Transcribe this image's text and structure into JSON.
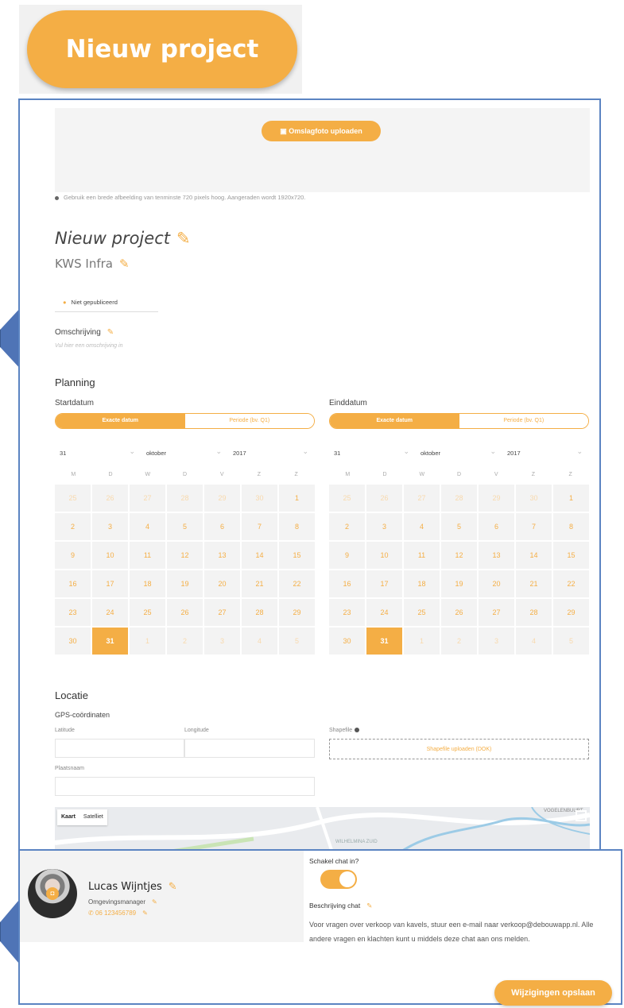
{
  "top_button": {
    "label": "Nieuw project"
  },
  "cover": {
    "upload_label": "Omslagfoto uploaden",
    "hint": "Gebruik een brede afbeelding van tenminste 720 pixels hoog. Aangeraden wordt 1920x720."
  },
  "project": {
    "title": "Nieuw project",
    "company": "KWS Infra",
    "status": "Niet gepubliceerd"
  },
  "description": {
    "label": "Omschrijving",
    "placeholder": "Vul hier een omschrijving in"
  },
  "planning": {
    "heading": "Planning",
    "start": {
      "label": "Startdatum",
      "toggle_exact": "Exacte datum",
      "toggle_period": "Periode (bv. Q1)",
      "day": "31",
      "month": "oktober",
      "year": "2017"
    },
    "end": {
      "label": "Einddatum",
      "toggle_exact": "Exacte datum",
      "toggle_period": "Periode (bv. Q1)",
      "day": "31",
      "month": "oktober",
      "year": "2017"
    },
    "weekdays": [
      "M",
      "D",
      "W",
      "D",
      "V",
      "Z",
      "Z"
    ],
    "days": [
      "25",
      "26",
      "27",
      "28",
      "29",
      "30",
      "1",
      "2",
      "3",
      "4",
      "5",
      "6",
      "7",
      "8",
      "9",
      "10",
      "11",
      "12",
      "13",
      "14",
      "15",
      "16",
      "17",
      "18",
      "19",
      "20",
      "21",
      "22",
      "23",
      "24",
      "25",
      "26",
      "27",
      "28",
      "29",
      "30",
      "31",
      "1",
      "2",
      "3",
      "4",
      "5"
    ],
    "selected_day": "31"
  },
  "location": {
    "heading": "Locatie",
    "gps_label": "GPS-coördinaten",
    "latitude_label": "Latitude",
    "longitude_label": "Longitude",
    "shapefile_label": "Shapefile",
    "shapefile_upload": "Shapefile uploaden (DOK)",
    "place_label": "Plaatsnaam"
  },
  "map": {
    "tab_map": "Kaart",
    "tab_satellite": "Satelliet",
    "label1": "VOGELENBUURT",
    "label2": "WILHELMINA ZUID"
  },
  "contact": {
    "name": "Lucas Wijntjes",
    "role": "Omgevingsmanager",
    "phone": "06 123456789",
    "chat_toggle_label": "Schakel chat in?",
    "chat_desc_label": "Beschrijving chat",
    "chat_desc": "Voor vragen over verkoop van kavels, stuur een e-mail naar verkoop@debouwapp.nl. Alle andere vragen en klachten kunt u middels deze chat aan ons melden.",
    "save_label": "Wijzigingen opslaan"
  },
  "colors": {
    "accent": "#f4ae45",
    "frame": "#5b84c2",
    "callout": "#4f74b6"
  }
}
